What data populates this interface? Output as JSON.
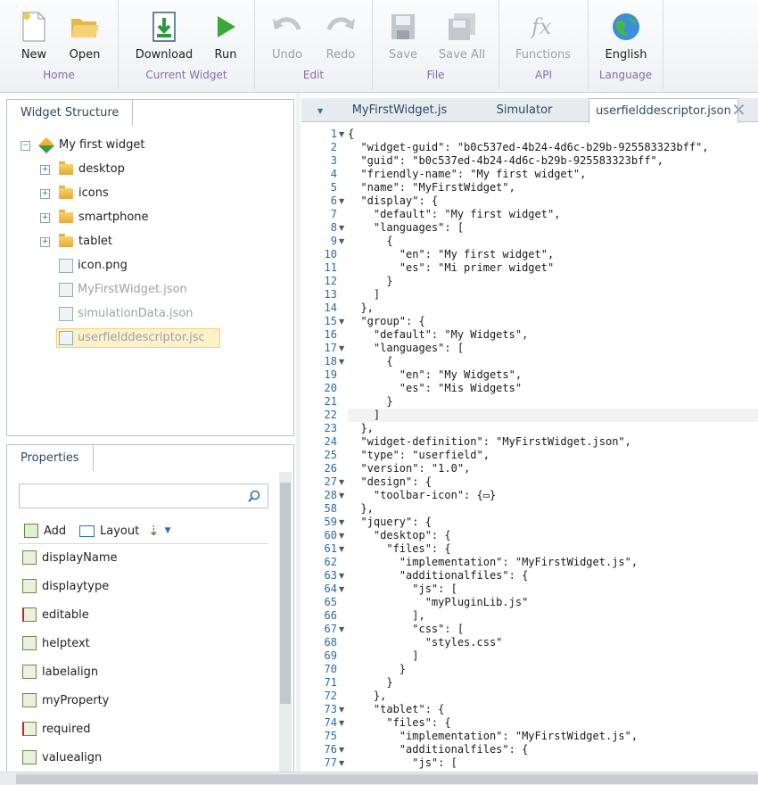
{
  "ribbon": {
    "groups": [
      {
        "label": "Home",
        "buttons": [
          {
            "label": "New",
            "icon": "new-file-icon"
          },
          {
            "label": "Open",
            "icon": "open-folder-icon"
          }
        ]
      },
      {
        "label": "Current Widget",
        "buttons": [
          {
            "label": "Download",
            "icon": "download-icon"
          },
          {
            "label": "Run",
            "icon": "play-icon"
          }
        ]
      },
      {
        "label": "Edit",
        "buttons": [
          {
            "label": "Undo",
            "icon": "undo-icon"
          },
          {
            "label": "Redo",
            "icon": "redo-icon"
          }
        ]
      },
      {
        "label": "File",
        "buttons": [
          {
            "label": "Save",
            "icon": "save-icon"
          },
          {
            "label": "Save All",
            "icon": "save-all-icon"
          }
        ]
      },
      {
        "label": "API",
        "buttons": [
          {
            "label": "Functions",
            "icon": "fx-icon"
          }
        ]
      },
      {
        "label": "Language",
        "buttons": [
          {
            "label": "English",
            "icon": "globe-icon"
          }
        ]
      }
    ]
  },
  "widget_structure": {
    "tab": "Widget Structure",
    "root": "My first widget",
    "folders": [
      "desktop",
      "icons",
      "smartphone",
      "tablet"
    ],
    "files": [
      "icon.png",
      "MyFirstWidget.json",
      "simulationData.json",
      "userfielddescriptor.jsc"
    ]
  },
  "properties": {
    "tab": "Properties",
    "search_placeholder": "",
    "toolbar": {
      "add": "Add",
      "layout": "Layout"
    },
    "items": [
      "displayName",
      "displaytype",
      "editable",
      "helptext",
      "labelalign",
      "myProperty",
      "required",
      "valuealign"
    ]
  },
  "editor": {
    "tabs": [
      "MyFirstWidget.js",
      "Simulator",
      "userfielddescriptor.json"
    ],
    "active_tab": "userfielddescriptor.json",
    "lines": [
      {
        "n": "1",
        "t": "{"
      },
      {
        "n": "2",
        "t": "  \"widget-guid\": \"b0c537ed-4b24-4d6c-b29b-925583323bff\","
      },
      {
        "n": "3",
        "t": "  \"guid\": \"b0c537ed-4b24-4d6c-b29b-925583323bff\","
      },
      {
        "n": "4",
        "t": "  \"friendly-name\": \"My first widget\","
      },
      {
        "n": "5",
        "t": "  \"name\": \"MyFirstWidget\","
      },
      {
        "n": "6",
        "t": "  \"display\": {"
      },
      {
        "n": "7",
        "t": "    \"default\": \"My first widget\","
      },
      {
        "n": "8",
        "t": "    \"languages\": ["
      },
      {
        "n": "9",
        "t": "      {"
      },
      {
        "n": "10",
        "t": "        \"en\": \"My first widget\","
      },
      {
        "n": "11",
        "t": "        \"es\": \"Mi primer widget\""
      },
      {
        "n": "12",
        "t": "      }"
      },
      {
        "n": "13",
        "t": "    ]"
      },
      {
        "n": "14",
        "t": "  },"
      },
      {
        "n": "15",
        "t": "  \"group\": {"
      },
      {
        "n": "16",
        "t": "    \"default\": \"My Widgets\","
      },
      {
        "n": "17",
        "t": "    \"languages\": ["
      },
      {
        "n": "18",
        "t": "      {"
      },
      {
        "n": "19",
        "t": "        \"en\": \"My Widgets\","
      },
      {
        "n": "20",
        "t": "        \"es\": \"Mis Widgets\""
      },
      {
        "n": "21",
        "t": "      }"
      },
      {
        "n": "22",
        "t": "    ]"
      },
      {
        "n": "23",
        "t": "  },"
      },
      {
        "n": "24",
        "t": "  \"widget-definition\": \"MyFirstWidget.json\","
      },
      {
        "n": "25",
        "t": "  \"type\": \"userfield\","
      },
      {
        "n": "26",
        "t": "  \"version\": \"1.0\","
      },
      {
        "n": "27",
        "t": "  \"design\": {"
      },
      {
        "n": "28",
        "t": "    \"toolbar-icon\": {▭}"
      },
      {
        "n": "58",
        "t": "  },"
      },
      {
        "n": "59",
        "t": "  \"jquery\": {"
      },
      {
        "n": "60",
        "t": "    \"desktop\": {"
      },
      {
        "n": "61",
        "t": "      \"files\": {"
      },
      {
        "n": "62",
        "t": "        \"implementation\": \"MyFirstWidget.js\","
      },
      {
        "n": "63",
        "t": "        \"additionalfiles\": {"
      },
      {
        "n": "64",
        "t": "          \"js\": ["
      },
      {
        "n": "65",
        "t": "            \"myPluginLib.js\""
      },
      {
        "n": "66",
        "t": "          ],"
      },
      {
        "n": "67",
        "t": "          \"css\": ["
      },
      {
        "n": "68",
        "t": "            \"styles.css\""
      },
      {
        "n": "69",
        "t": "          ]"
      },
      {
        "n": "70",
        "t": "        }"
      },
      {
        "n": "71",
        "t": "      }"
      },
      {
        "n": "72",
        "t": "    },"
      },
      {
        "n": "73",
        "t": "    \"tablet\": {"
      },
      {
        "n": "74",
        "t": "      \"files\": {"
      },
      {
        "n": "75",
        "t": "        \"implementation\": \"MyFirstWidget.js\","
      },
      {
        "n": "76",
        "t": "        \"additionalfiles\": {"
      },
      {
        "n": "77",
        "t": "          \"js\": ["
      }
    ],
    "foldable_lines": [
      "1",
      "6",
      "8",
      "9",
      "15",
      "17",
      "18",
      "27",
      "28",
      "59",
      "60",
      "61",
      "63",
      "64",
      "67",
      "73",
      "74",
      "76",
      "77"
    ]
  }
}
